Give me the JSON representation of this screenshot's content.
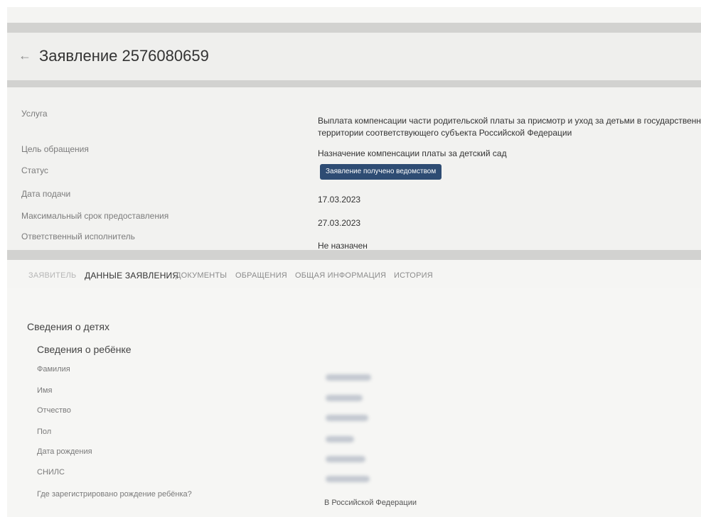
{
  "header": {
    "title": "Заявление 2576080659"
  },
  "info": {
    "service_label": "Услуга",
    "service_value_line1": "Выплата компенсации части родительской платы за присмотр и уход за детьми в государственных и муниципа",
    "service_value_line2": "территории соответствующего субъекта Российской Федерации",
    "purpose_label": "Цель обращения",
    "purpose_value": "Назначение компенсации платы за детский сад",
    "status_label": "Статус",
    "status_value": "Заявление получено ведомством",
    "submit_date_label": "Дата подачи",
    "submit_date_value": "17.03.2023",
    "deadline_label": "Максимальный срок предоставления",
    "deadline_value": "27.03.2023",
    "executor_label": "Ответственный исполнитель",
    "executor_value": "Не назначен"
  },
  "tabs": [
    {
      "label": "ЗАЯВИТЕЛЬ"
    },
    {
      "label": "ДАННЫЕ ЗАЯВЛЕНИЯ"
    },
    {
      "label": "ДОКУМЕНТЫ"
    },
    {
      "label": "ОБРАЩЕНИЯ"
    },
    {
      "label": "ОБЩАЯ ИНФОРМАЦИЯ"
    },
    {
      "label": "ИСТОРИЯ"
    }
  ],
  "content": {
    "section_title": "Сведения о детях",
    "subsection_title": "Сведения о ребёнке",
    "fields": [
      {
        "label": "Фамилия"
      },
      {
        "label": "Имя"
      },
      {
        "label": "Отчество"
      },
      {
        "label": "Пол"
      },
      {
        "label": "Дата рождения"
      },
      {
        "label": "СНИЛС"
      },
      {
        "label": "Где зарегистрировано рождение ребёнка?",
        "value": "В Российской Федерации"
      }
    ]
  },
  "colors": {
    "badge": "#2e4c73",
    "band": "#d2d2d0"
  },
  "icons": {
    "back": "arrow-left-icon"
  }
}
